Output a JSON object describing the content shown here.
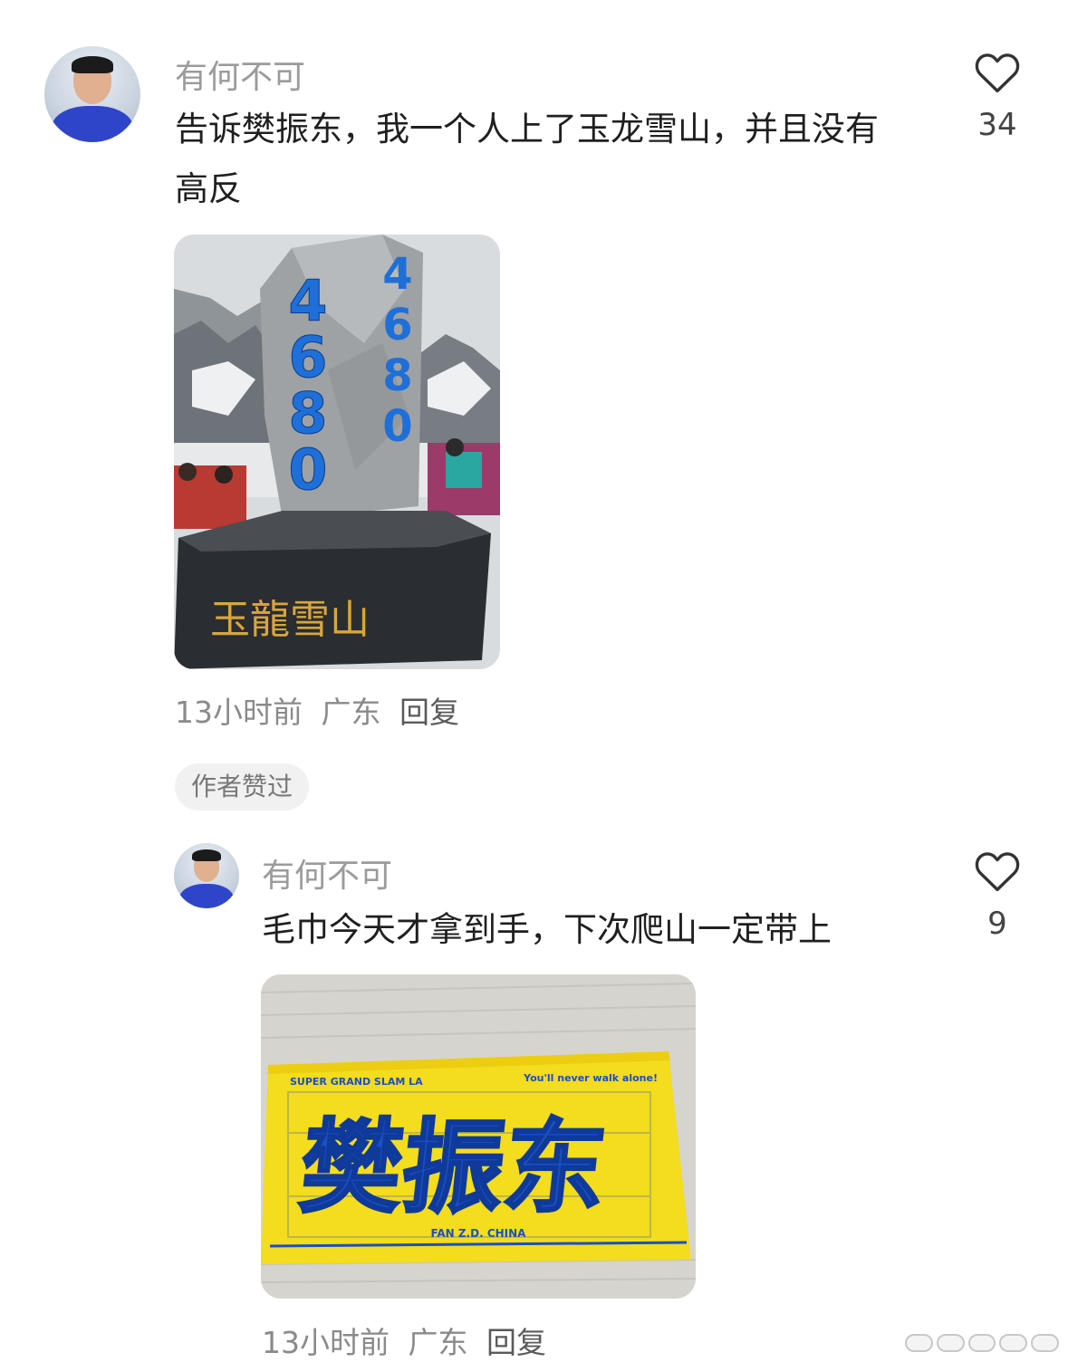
{
  "comments": [
    {
      "username": "有何不可",
      "text": "告诉樊振东，我一个人上了玉龙雪山，并且没有高反",
      "likes": "34",
      "time": "13小时前",
      "location": "广东",
      "reply_label": "回复",
      "image": {
        "stone_number": "4680",
        "plaque_text": "玉龍雪山"
      }
    },
    {
      "badge": "作者赞过",
      "username": "有何不可",
      "text": "毛巾今天才拿到手，下次爬山一定带上",
      "likes": "9",
      "time": "13小时前",
      "location": "广东",
      "reply_label": "回复",
      "image": {
        "towel_top_left": "SUPER GRAND SLAM LA",
        "towel_top_right": "You'll never walk alone!",
        "towel_name": "樊振东",
        "towel_bottom": "FAN Z.D. CHINA"
      }
    }
  ],
  "colors": {
    "stone_digits": "#1f6fd8",
    "towel_yellow": "#f4dc1e",
    "towel_blue": "#1a4fc4"
  }
}
